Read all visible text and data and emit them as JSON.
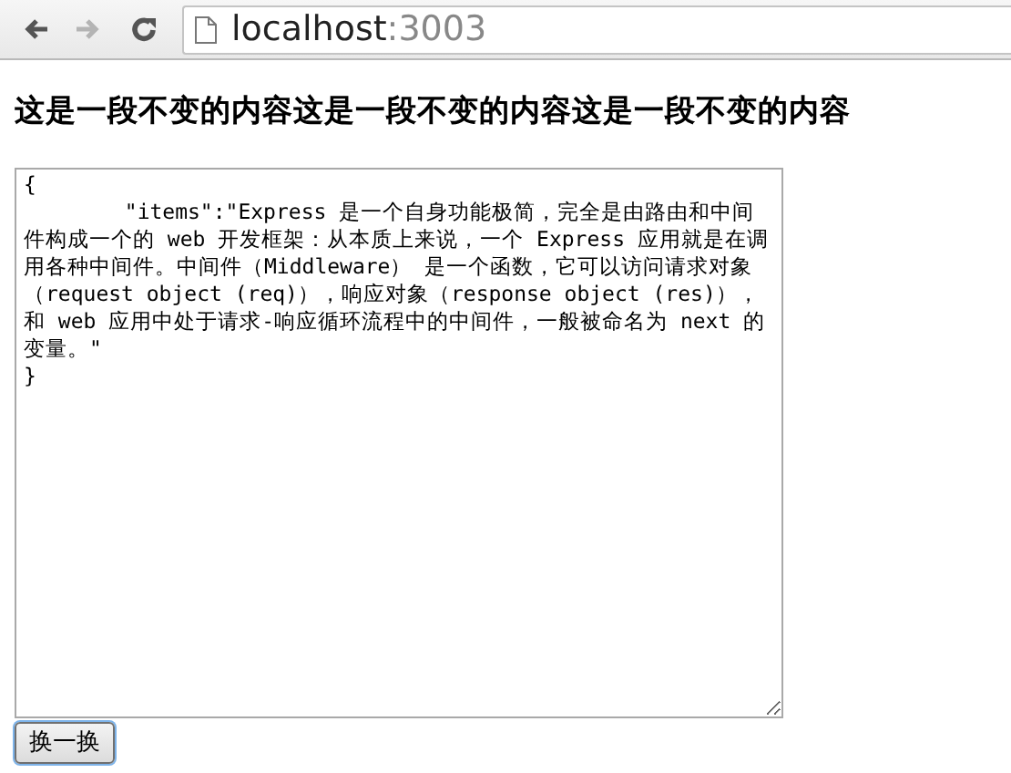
{
  "browser": {
    "nav_buttons": [
      {
        "kind": "back",
        "disabled": false
      },
      {
        "kind": "forward",
        "disabled": true
      },
      {
        "kind": "reload",
        "disabled": false
      }
    ],
    "address": {
      "host": "localhost",
      "port": ":3003"
    }
  },
  "heading": "这是一段不变的内容这是一段不变的内容这是一段不变的内容",
  "text_area": {
    "value": "{\n\t\"items\":\"Express 是一个自身功能极简，完全是由路由和中间件构成一个的 web 开发框架：从本质上来说，一个 Express 应用就是在调用各种中间件。中间件（Middleware） 是一个函数，它可以访问请求对象（request object (req)），响应对象（response object (res)），和 web 应用中处于请求-响应循环流程中的中间件，一般被命名为 next 的变量。\"\n}"
  },
  "button": "换一换"
}
